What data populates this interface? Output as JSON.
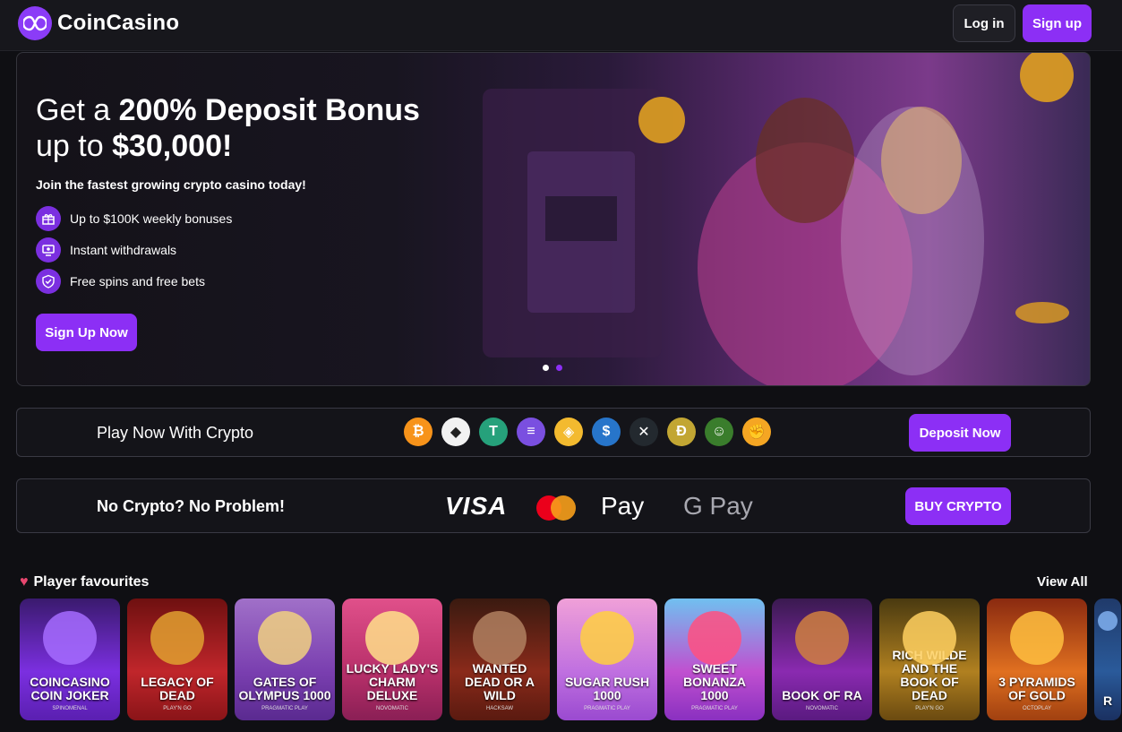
{
  "header": {
    "brand": "CoinCasino",
    "login_label": "Log in",
    "signup_label": "Sign up"
  },
  "hero": {
    "title_prefix": "Get a ",
    "title_bold": "200% Deposit Bonus",
    "title_line2_prefix": "up to ",
    "title_line2_bold": "$30,000!",
    "subtitle": "Join the fastest growing crypto casino today!",
    "features": [
      {
        "label": "Up to $100K weekly bonuses",
        "icon": "gift-icon"
      },
      {
        "label": "Instant withdrawals",
        "icon": "withdraw-icon"
      },
      {
        "label": "Free spins and free bets",
        "icon": "shield-check-icon"
      }
    ],
    "cta_label": "Sign Up Now",
    "slides": 2,
    "active_slide": 2
  },
  "crypto_panel": {
    "label": "Play Now With Crypto",
    "coins": [
      {
        "icon": "bitcoin-icon",
        "glyph": "₿",
        "color": "#f7931a"
      },
      {
        "icon": "ethereum-icon",
        "glyph": "◆",
        "color": "#f2f2f2"
      },
      {
        "icon": "tether-icon",
        "glyph": "T",
        "color": "#26a17b"
      },
      {
        "icon": "solana-icon",
        "glyph": "≡",
        "color": "#7a4fe0"
      },
      {
        "icon": "bnb-icon",
        "glyph": "◈",
        "color": "#f3ba2f"
      },
      {
        "icon": "usdc-icon",
        "glyph": "$",
        "color": "#2775ca"
      },
      {
        "icon": "xrp-icon",
        "glyph": "✕",
        "color": "#23292f"
      },
      {
        "icon": "dogecoin-icon",
        "glyph": "Ð",
        "color": "#c2a633"
      },
      {
        "icon": "pepe-icon",
        "glyph": "☺",
        "color": "#3a7d2c"
      },
      {
        "icon": "bonk-icon",
        "glyph": "✊",
        "color": "#f5a623"
      }
    ],
    "cta_label": "Deposit Now"
  },
  "fiat_panel": {
    "label": "No Crypto? No Problem!",
    "visa": "VISA",
    "apple_pay": " Pay",
    "google_pay": "G Pay",
    "cta_label": "BUY CRYPTO"
  },
  "favourites": {
    "title": "Player favourites",
    "view_all": "View All",
    "games": [
      {
        "title": "COINCASINO COIN JOKER",
        "provider": "SPINOMENAL",
        "bg": "linear-gradient(180deg,#3a1a6e,#7b2fe0 60%,#5a1fb0)",
        "art": "#a66cff"
      },
      {
        "title": "LEGACY OF DEAD",
        "provider": "PLAY'N GO",
        "bg": "linear-gradient(180deg,#6e1010,#c0262b 60%,#8a1418)",
        "art": "#e0a030"
      },
      {
        "title": "GATES OF OLYMPUS 1000",
        "provider": "PRAGMATIC PLAY",
        "bg": "linear-gradient(180deg,#a070c8,#7a3fb0 60%,#5a2a90)",
        "art": "#f0d080"
      },
      {
        "title": "LUCKY LADY'S CHARM DELUXE",
        "provider": "NOVOMATIC",
        "bg": "linear-gradient(180deg,#e0508a,#b8306a 60%,#8a1f55)",
        "art": "#ffe08a"
      },
      {
        "title": "WANTED DEAD OR A WILD",
        "provider": "HACKSAW",
        "bg": "linear-gradient(180deg,#3a1a10,#8a2a1a 60%,#5a1a10)",
        "art": "#b08060"
      },
      {
        "title": "SUGAR RUSH 1000",
        "provider": "PRAGMATIC PLAY",
        "bg": "linear-gradient(180deg,#f0a0d8,#c070e0 60%,#9a4ad0)",
        "art": "#ffd040"
      },
      {
        "title": "SWEET BONANZA 1000",
        "provider": "PRAGMATIC PLAY",
        "bg": "linear-gradient(180deg,#70c0f0,#c050d0 60%,#8a30c0)",
        "art": "#ff5080"
      },
      {
        "title": "BOOK OF RA",
        "provider": "NOVOMATIC",
        "bg": "linear-gradient(180deg,#3a1a50,#8a2ab0 60%,#5a1a80)",
        "art": "#d08040"
      },
      {
        "title": "RICH WILDE AND THE BOOK OF DEAD",
        "provider": "PLAY'N GO",
        "bg": "linear-gradient(180deg,#4a3a10,#b08020 60%,#6a4a10)",
        "art": "#ffd060"
      },
      {
        "title": "3 PYRAMIDS OF GOLD",
        "provider": "OCTOPLAY",
        "bg": "linear-gradient(180deg,#8a2a10,#e07020 60%,#a04010)",
        "art": "#ffc040"
      },
      {
        "title": "R",
        "provider": "",
        "bg": "linear-gradient(180deg,#203a6a,#2a5a9a 60%,#1a3060)",
        "art": "#80b0f0"
      }
    ]
  }
}
